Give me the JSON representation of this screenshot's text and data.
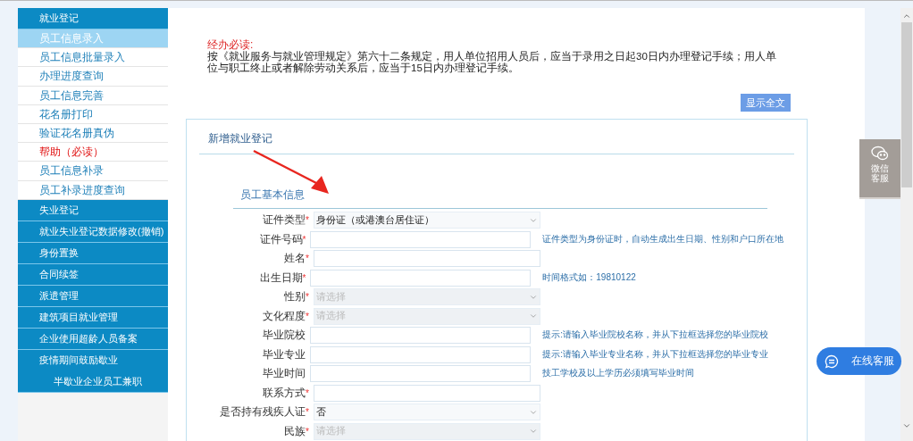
{
  "sidebar": {
    "sections": [
      {
        "label": "就业登记",
        "items": [
          {
            "label": "员工信息录入",
            "selected": true,
            "kind": "normal"
          },
          {
            "label": "员工信息批量录入",
            "selected": false,
            "kind": "normal"
          },
          {
            "label": "办理进度查询",
            "selected": false,
            "kind": "normal"
          },
          {
            "label": "员工信息完善",
            "selected": false,
            "kind": "normal"
          },
          {
            "label": "花名册打印",
            "selected": false,
            "kind": "normal"
          },
          {
            "label": "验证花名册真伪",
            "selected": false,
            "kind": "normal"
          },
          {
            "label": "帮助（必读）",
            "selected": false,
            "kind": "warning"
          },
          {
            "label": "员工信息补录",
            "selected": false,
            "kind": "normal"
          },
          {
            "label": "员工补录进度查询",
            "selected": false,
            "kind": "normal"
          }
        ]
      },
      {
        "label": "失业登记"
      },
      {
        "label": "就业失业登记数据修改(撤销)"
      },
      {
        "label": "身份置换"
      },
      {
        "label": "合同续签"
      },
      {
        "label": "派遣管理"
      },
      {
        "label": "建筑项目就业管理"
      },
      {
        "label": "企业使用超龄人员备案"
      },
      {
        "label": "疫情期间鼓励歇业",
        "sublabel": "半歇业企业员工兼职"
      }
    ]
  },
  "notice": {
    "heading": "经办必读:",
    "text": "按《就业服务与就业管理规定》第六十二条规定，用人单位招用人员后，应当于录用之日起30日内办理登记手续；用人单位与职工终止或者解除劳动关系后，应当于15日内办理登记手续。",
    "button": "显示全文"
  },
  "panel": {
    "title": "新增就业登记",
    "section": "员工基本信息",
    "fields": [
      {
        "label": "证件类型",
        "required_mark": "*",
        "kind": "select",
        "value": "身份证（或港澳台居住证）"
      },
      {
        "label": "证件号码",
        "required_mark": "*",
        "kind": "input",
        "hint": "证件类型为身份证时，自动生成出生日期、性别和户口所在地"
      },
      {
        "label": "姓名",
        "required_mark": "*",
        "kind": "input"
      },
      {
        "label": "出生日期",
        "required_mark": "*",
        "kind": "input",
        "hint": "时间格式如：19810122"
      },
      {
        "label": "性别",
        "required_mark": "*",
        "kind": "select",
        "placeholder": "请选择"
      },
      {
        "label": "文化程度",
        "required_mark": "*",
        "kind": "select",
        "placeholder": "请选择"
      },
      {
        "label": "毕业院校",
        "kind": "input",
        "hint": "提示:请输入毕业院校名称，并从下拉框选择您的毕业院校"
      },
      {
        "label": "毕业专业",
        "kind": "input",
        "hint": "提示:请输入毕业专业名称，并从下拉框选择您的毕业专业"
      },
      {
        "label": "毕业时间",
        "kind": "input",
        "hint": "技工学校及以上学历必须填写毕业时间"
      },
      {
        "label": "联系方式",
        "required_mark": "*",
        "kind": "input"
      },
      {
        "label": "是否持有残疾人证",
        "required_mark": "*",
        "kind": "select",
        "value": "否"
      },
      {
        "label": "民族",
        "required_mark": "*",
        "kind": "select",
        "placeholder": "请选择"
      }
    ]
  },
  "float": {
    "wechat": "微信客服",
    "online": "在线客服"
  }
}
